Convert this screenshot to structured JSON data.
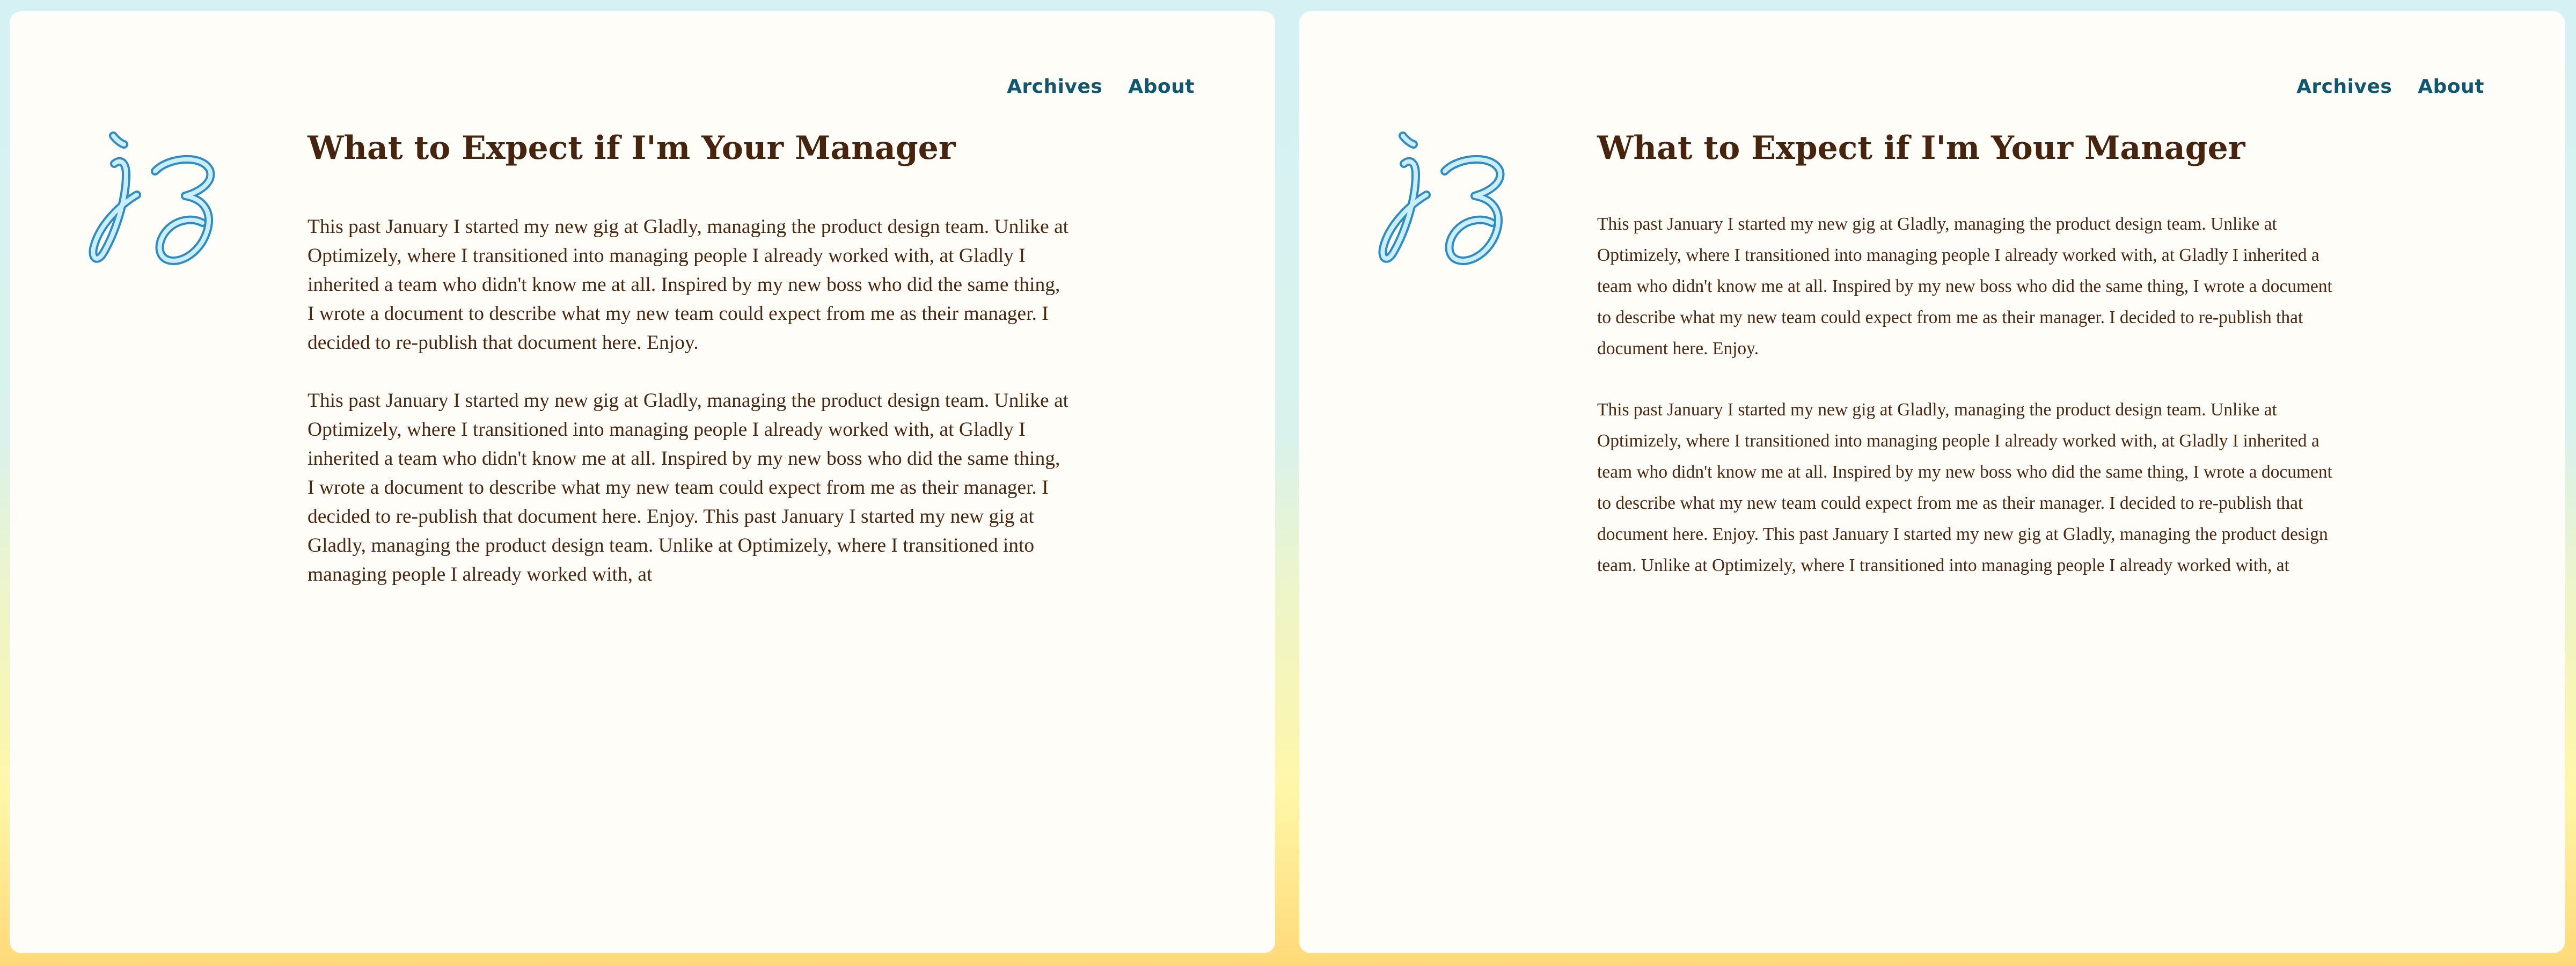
{
  "nav": {
    "archives": "Archives",
    "about": "About"
  },
  "logo": {
    "icon": "jz-signature-icon",
    "color_fill": "#cbeefc",
    "color_stroke": "#2e8cc2"
  },
  "post": {
    "title": "What to Expect if I'm Your Manager",
    "paragraph_1": "This past January I started my new gig at Gladly, managing the product design team. Unlike at Optimizely, where I transitioned into managing people I already worked with, at Gladly I inherited a team who didn't know me at all. Inspired by my new boss who did the same thing, I wrote a document to describe what my new team could expect from me as their manager. I decided to re-publish that document here. Enjoy.",
    "paragraph_2": "This past January I started my new gig at Gladly, managing the product design team. Unlike at Optimizely, where I transitioned into managing people I already worked with, at Gladly I inherited a team who didn't know me at all. Inspired by my new boss who did the same thing, I wrote a document to describe what my new team could expect from me as their manager. I decided to re-publish that document here. Enjoy. This past January I started my new gig at Gladly, managing the product design team. Unlike at Optimizely, where I transitioned into managing people I already worked with, at"
  },
  "colors": {
    "nav_link": "#11576e",
    "title": "#46240d",
    "body_text": "#4a2810",
    "panel_bg": "#fffdf7"
  }
}
